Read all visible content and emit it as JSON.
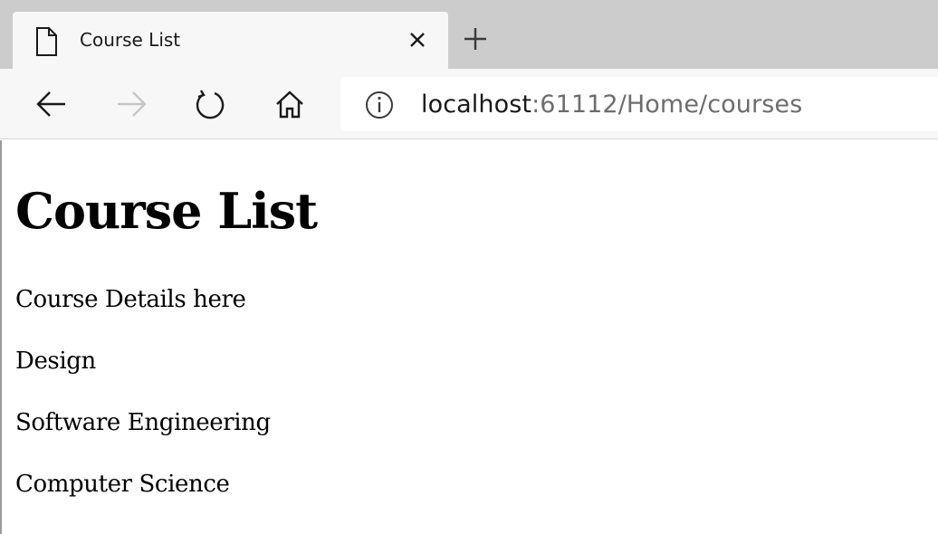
{
  "browser": {
    "tab": {
      "title": "Course List",
      "icon": "page-icon",
      "close_icon": "close-icon"
    },
    "new_tab_icon": "plus-icon",
    "nav": {
      "back_icon": "arrow-left-icon",
      "forward_icon": "arrow-right-icon",
      "refresh_icon": "refresh-icon",
      "home_icon": "home-icon"
    },
    "address": {
      "info_icon": "info-icon",
      "host": "localhost",
      "path": ":61112/Home/courses"
    }
  },
  "page": {
    "heading": "Course List",
    "items": [
      "Course Details here",
      "Design",
      "Software Engineering",
      "Computer Science"
    ]
  },
  "colors": {
    "tabstrip": "#cccccc",
    "toolbar": "#f7f7f7",
    "url_muted": "#6d6d6d"
  }
}
